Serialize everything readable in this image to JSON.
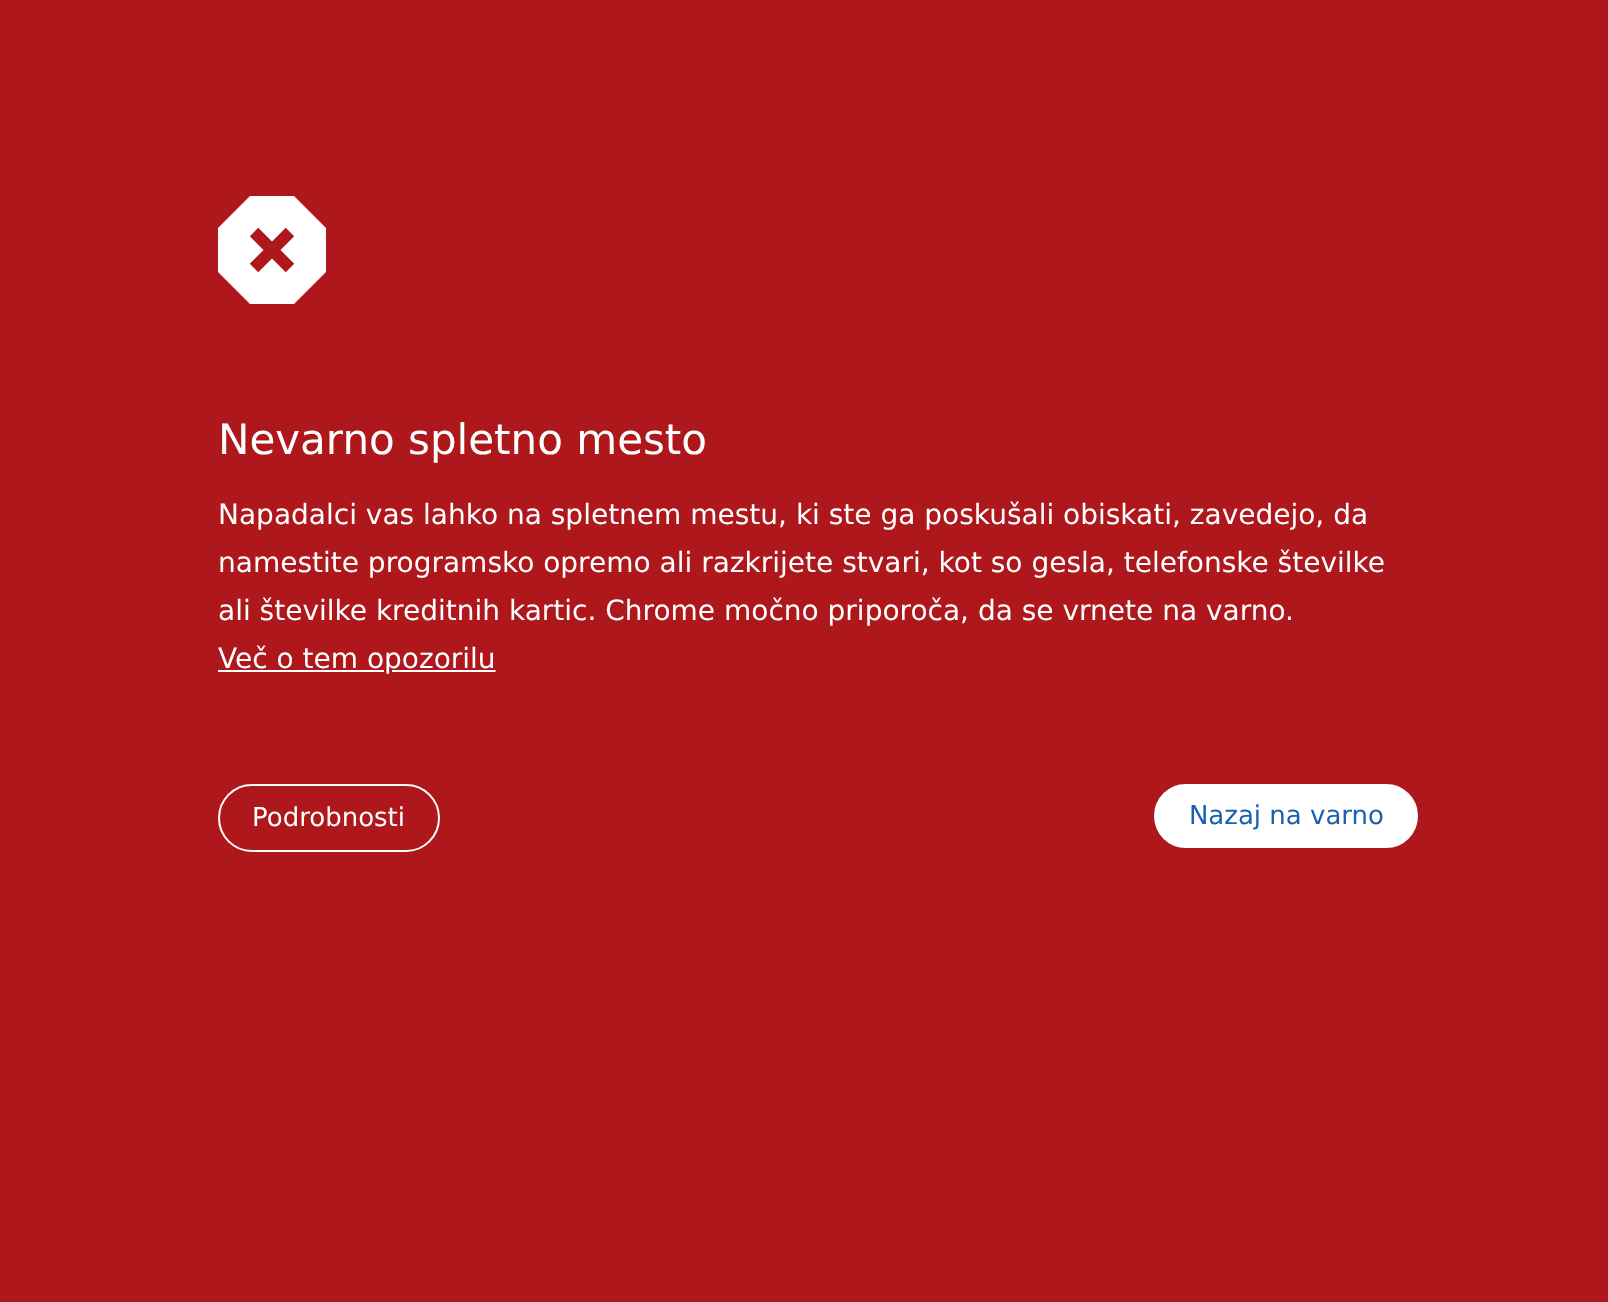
{
  "title": "Nevarno spletno mesto",
  "message": {
    "text": "Napadalci vas lahko na spletnem mestu, ki ste ga poskušali obiskati, zavedejo, da namestite programsko opremo ali razkrijete stvari, kot so gesla, telefonske številke ali številke kreditnih kartic. Chrome močno priporoča, da se vrnete na varno.",
    "link": "Več o tem opozorilu"
  },
  "buttons": [
    {
      "label": "Podrobnosti",
      "kind": "secondary"
    },
    {
      "label": "Nazaj na varno",
      "kind": "primary"
    }
  ]
}
